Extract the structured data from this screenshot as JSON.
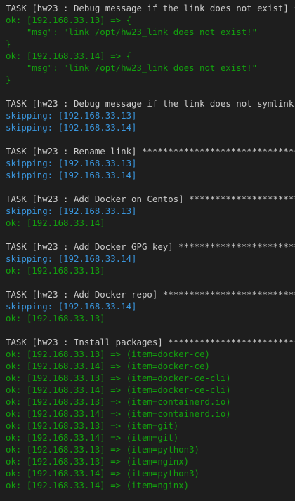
{
  "colors": {
    "background": "#1e1e1e",
    "task": "#cccccc",
    "ok": "#13a10e",
    "skipping": "#3a96dd"
  },
  "lines": [
    "TASK [hw23 : Debug message if the link does not exist] *******",
    "ok: [192.168.33.13] => {",
    "    \"msg\": \"link /opt/hw23_link does not exist!\"",
    "}",
    "ok: [192.168.33.14] => {",
    "    \"msg\": \"link /opt/hw23_link does not exist!\"",
    "}",
    "TASK [hw23 : Debug message if the link does not symlink] *****",
    "skipping: [192.168.33.13]",
    "skipping: [192.168.33.14]",
    "TASK [hw23 : Rename link] ************************************",
    "skipping: [192.168.33.13]",
    "skipping: [192.168.33.14]",
    "TASK [hw23 : Add Docker on Centos] ***************************",
    "skipping: [192.168.33.13]",
    "ok: [192.168.33.14]",
    "TASK [hw23 : Add Docker GPG key] *****************************",
    "skipping: [192.168.33.14]",
    "ok: [192.168.33.13]",
    "TASK [hw23 : Add Docker repo] ********************************",
    "skipping: [192.168.33.14]",
    "ok: [192.168.33.13]",
    "TASK [hw23 : Install packages] *******************************",
    "ok: [192.168.33.13] => (item=docker-ce)",
    "ok: [192.168.33.14] => (item=docker-ce)",
    "ok: [192.168.33.13] => (item=docker-ce-cli)",
    "ok: [192.168.33.14] => (item=docker-ce-cli)",
    "ok: [192.168.33.13] => (item=containerd.io)",
    "ok: [192.168.33.14] => (item=containerd.io)",
    "ok: [192.168.33.13] => (item=git)",
    "ok: [192.168.33.14] => (item=git)",
    "ok: [192.168.33.13] => (item=python3)",
    "ok: [192.168.33.13] => (item=nginx)",
    "ok: [192.168.33.14] => (item=python3)",
    "ok: [192.168.33.14] => (item=nginx)"
  ]
}
